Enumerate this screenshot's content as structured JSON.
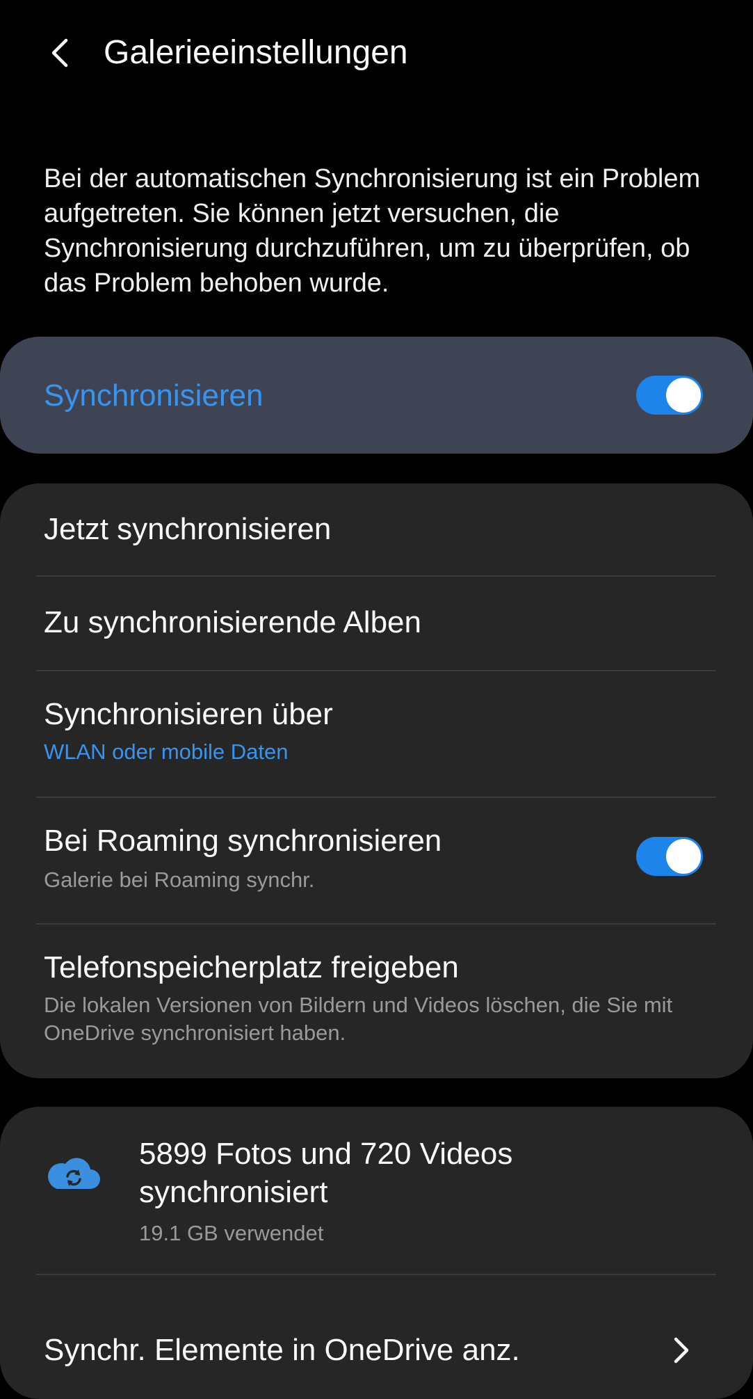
{
  "header": {
    "title": "Galerieeinstellungen",
    "back_icon": "back-arrow-icon"
  },
  "notice": "Bei der automatischen Synchronisierung ist ein Problem aufgetreten. Sie können jetzt versuchen, die Synchronisierung durchzuführen, um zu überprüfen, ob das Problem behoben wurde.",
  "sync": {
    "label": "Synchronisieren",
    "enabled": true
  },
  "settings": {
    "sync_now": {
      "label": "Jetzt synchronisieren"
    },
    "albums": {
      "label": "Zu synchronisierende Alben"
    },
    "sync_via": {
      "label": "Synchronisieren über",
      "value": "WLAN oder mobile Daten"
    },
    "roaming": {
      "label": "Bei Roaming synchronisieren",
      "sub": "Galerie bei Roaming synchr.",
      "enabled": true
    },
    "free_space": {
      "label": "Telefonspeicherplatz freigeben",
      "sub": "Die lokalen Versionen von Bildern und Videos löschen, die Sie mit OneDrive synchronisiert haben."
    }
  },
  "onedrive": {
    "icon": "cloud-sync-icon",
    "summary": "5899 Fotos und 720 Videos synchronisiert",
    "usage": "19.1 GB verwendet",
    "view_link": "Synchr. Elemente in OneDrive anz.",
    "chevron_icon": "chevron-right-icon"
  },
  "colors": {
    "accent": "#1d84ea",
    "accent_text": "#3795f0",
    "highlight_card": "#3f4455",
    "card": "#262626",
    "background": "#000000"
  }
}
